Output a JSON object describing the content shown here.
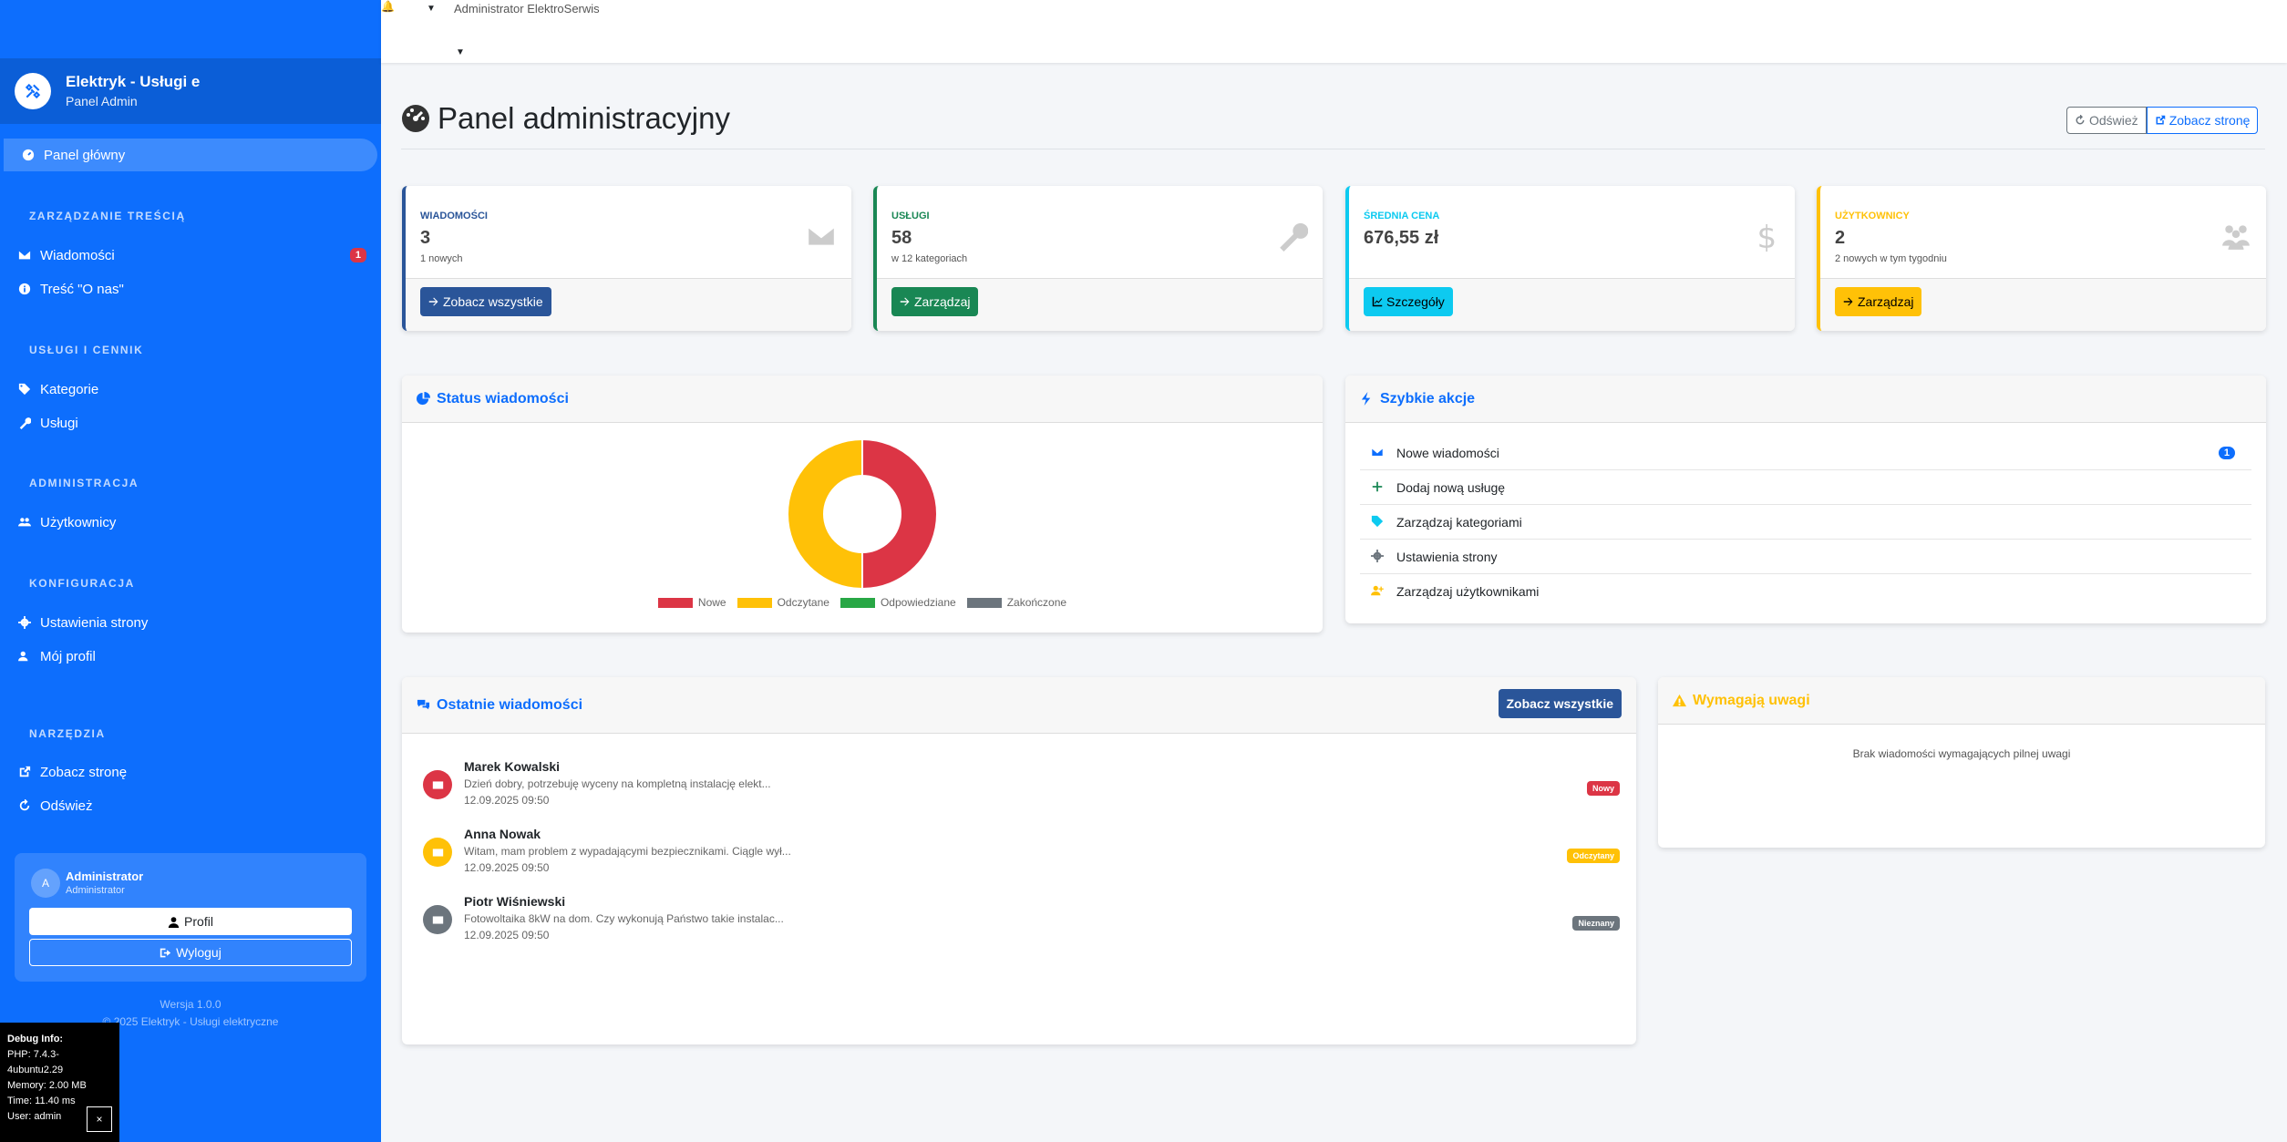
{
  "topbar": {
    "user_label": "Administrator ElektroSerwis"
  },
  "sidebar": {
    "brand_title": "Elektryk - Usługi e",
    "brand_sub": "Panel Admin",
    "nav_main": "Panel główny",
    "sections": {
      "content": "ZARZĄDZANIE TREŚCIĄ",
      "services": "USŁUGI I CENNIK",
      "admin": "ADMINISTRACJA",
      "config": "KONFIGURACJA",
      "tools": "NARZĘDZIA"
    },
    "items": {
      "messages": "Wiadomości",
      "messages_badge": "1",
      "about": "Treść \"O nas\"",
      "categories": "Kategorie",
      "services": "Usługi",
      "users": "Użytkownicy",
      "settings": "Ustawienia strony",
      "profile": "Mój profil",
      "view_site": "Zobacz stronę",
      "refresh": "Odśwież"
    },
    "user": {
      "avatar": "A",
      "name": "Administrator",
      "role": "Administrator",
      "profile_btn": "Profil",
      "logout_btn": "Wyloguj"
    },
    "version": "Wersja 1.0.0",
    "copyright": "© 2025 Elektryk - Usługi elektryczne"
  },
  "debug": {
    "title": "Debug Info:",
    "php": "PHP: 7.4.3-4ubuntu2.29",
    "memory": "Memory: 2.00 MB",
    "time": "Time: 11.40 ms",
    "user": "User: admin",
    "close": "×"
  },
  "header": {
    "title": "Panel administracyjny",
    "refresh_btn": "Odśwież",
    "view_site_btn": "Zobacz stronę"
  },
  "stats": [
    {
      "label": "WIADOMOŚCI",
      "value": "3",
      "sub": "1 nowych",
      "btn": "Zobacz wszystkie",
      "color": "#2a5599"
    },
    {
      "label": "USŁUGI",
      "value": "58",
      "sub": "w 12 kategoriach",
      "btn": "Zarządzaj",
      "color": "#198754"
    },
    {
      "label": "ŚREDNIA CENA",
      "value": "676,55 zł",
      "sub": "",
      "btn": "Szczegóły",
      "color": "#0dcaf0"
    },
    {
      "label": "UŻYTKOWNICY",
      "value": "2",
      "sub": "2 nowych w tym tygodniu",
      "btn": "Zarządzaj",
      "color": "#ffc107"
    }
  ],
  "status_card": {
    "title": "Status wiadomości"
  },
  "chart_data": {
    "type": "pie",
    "categories": [
      "Nowe",
      "Odczytane",
      "Odpowiedziane",
      "Zakończone"
    ],
    "values": [
      1,
      1,
      0,
      0
    ],
    "colors": [
      "#dc3545",
      "#ffc107",
      "#28a745",
      "#6c757d"
    ],
    "legend_position": "bottom"
  },
  "quick_actions": {
    "title": "Szybkie akcje",
    "items": [
      {
        "label": "Nowe wiadomości",
        "badge": "1"
      },
      {
        "label": "Dodaj nową usługę"
      },
      {
        "label": "Zarządzaj kategoriami"
      },
      {
        "label": "Ustawienia strony"
      },
      {
        "label": "Zarządzaj użytkownikami"
      }
    ]
  },
  "recent_messages": {
    "title": "Ostatnie wiadomości",
    "view_all_btn": "Zobacz wszystkie",
    "items": [
      {
        "name": "Marek Kowalski",
        "text": "Dzień dobry, potrzebuję wyceny na kompletną instalację elekt...",
        "date": "12.09.2025 09:50",
        "badge": "Nowy",
        "color": "#dc3545"
      },
      {
        "name": "Anna Nowak",
        "text": "Witam, mam problem z wypadającymi bezpiecznikami. Ciągle wył...",
        "date": "12.09.2025 09:50",
        "badge": "Odczytany",
        "color": "#ffc107"
      },
      {
        "name": "Piotr Wiśniewski",
        "text": "Fotowoltaika 8kW na dom. Czy wykonują Państwo takie instalac...",
        "date": "12.09.2025 09:50",
        "badge": "Nieznany",
        "color": "#6c757d"
      }
    ]
  },
  "attention": {
    "title": "Wymagają uwagi",
    "empty": "Brak wiadomości wymagających pilnej uwagi"
  }
}
